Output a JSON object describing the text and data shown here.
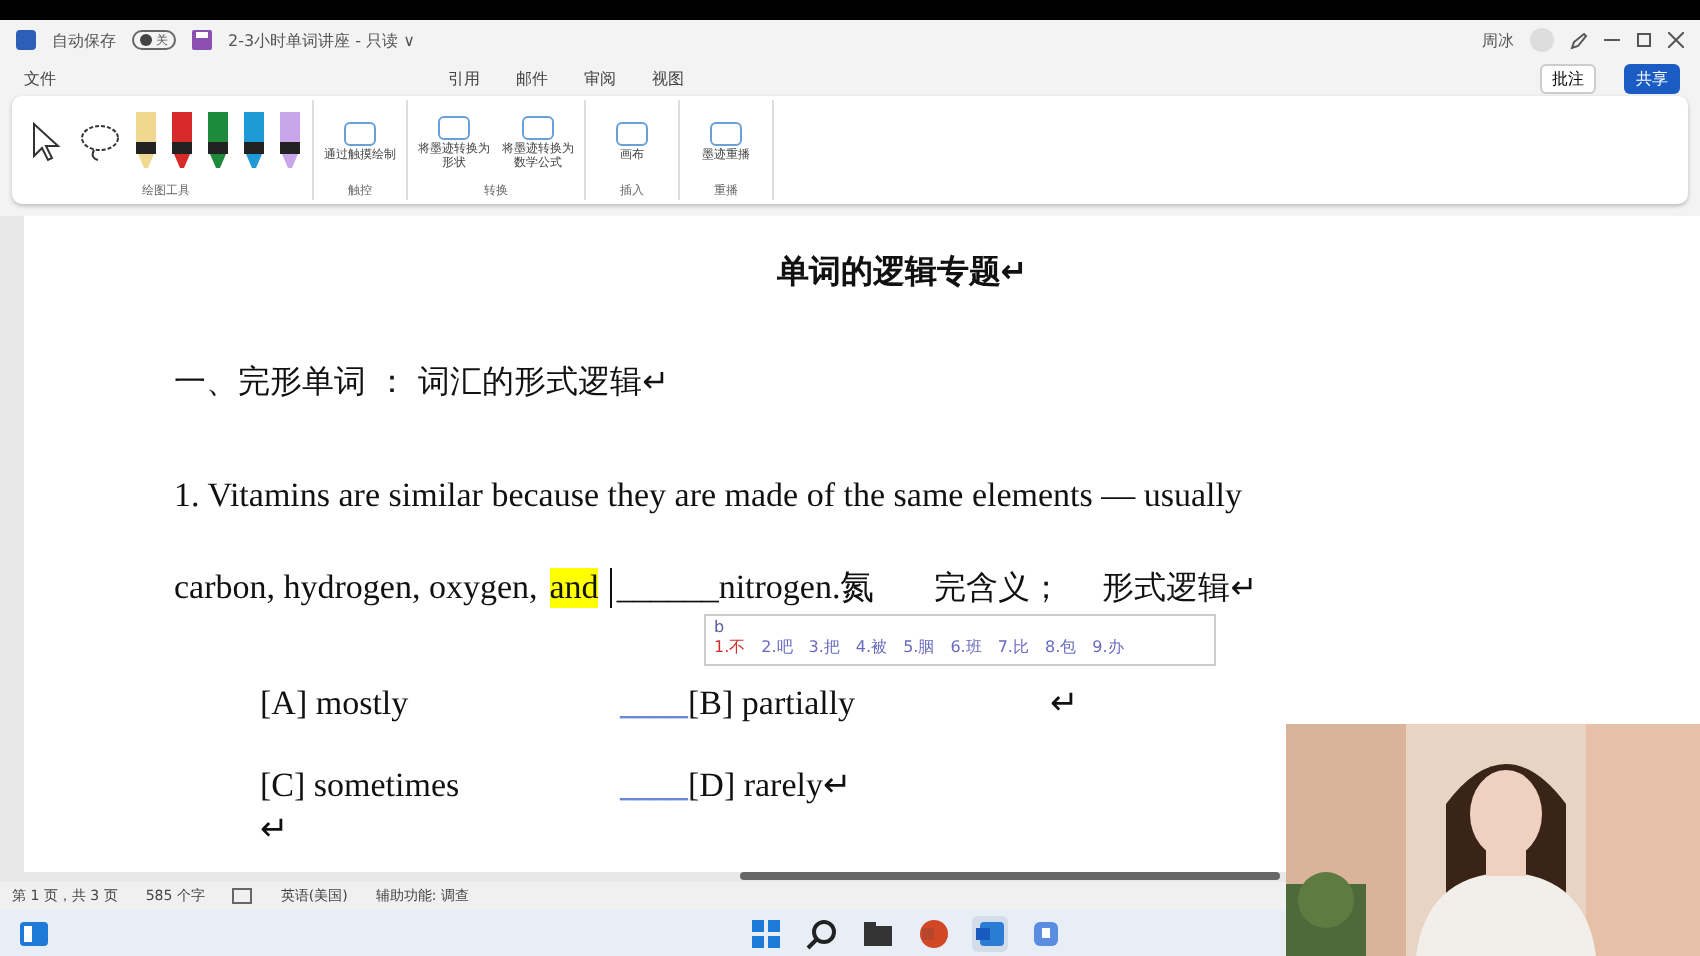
{
  "title_bar": {
    "autosave_label": "自动保存",
    "autosave_on": false,
    "toggle_text": "关",
    "document_title": "2-3小时单词讲座 - 只读 ∨",
    "user": "周冰"
  },
  "menu_tabs": [
    {
      "label": "文件",
      "selected": false
    },
    {
      "label": "引用",
      "selected": false
    },
    {
      "label": "邮件",
      "selected": false
    },
    {
      "label": "审阅",
      "selected": false
    },
    {
      "label": "视图",
      "selected": false
    }
  ],
  "ribbon": {
    "groups": [
      {
        "label": "绘图工具",
        "tools": [
          {
            "kind": "pointer"
          },
          {
            "kind": "lasso"
          },
          {
            "kind": "pen",
            "color": "#f0d890"
          },
          {
            "kind": "pen",
            "color": "#d92a2a"
          },
          {
            "kind": "pen",
            "color": "#1e8a3c"
          },
          {
            "kind": "pen",
            "color": "#1e9ad6"
          },
          {
            "kind": "pen",
            "color": "#c9a6ea"
          }
        ]
      },
      {
        "label": "触控",
        "buttons": [
          "通过触摸绘制"
        ]
      },
      {
        "label": "转换",
        "buttons": [
          "将墨迹转换为形状",
          "将墨迹转换为数学公式"
        ]
      },
      {
        "label": "插入",
        "buttons": [
          "画布"
        ]
      },
      {
        "label": "重播",
        "buttons": [
          "墨迹重播"
        ]
      }
    ]
  },
  "comment_button": "批注",
  "share_button": "共享",
  "document": {
    "title": "单词的逻辑专题↵",
    "heading": "一、完形单词 ： 词汇的形式逻辑↵",
    "question": {
      "line1": "1. Vitamins are similar because they are made of the same elements  —  usually",
      "line2_before": "carbon, hydrogen, oxygen,",
      "highlighted": "and",
      "blank": "______",
      "line2_after": "nitrogen.氮",
      "note1": "完含义；",
      "note2": "形式逻辑↵"
    },
    "ime": {
      "input": "b",
      "candidates": [
        {
          "text": "1.不",
          "selected": true
        },
        {
          "text": "2.吧",
          "selected": false
        },
        {
          "text": "3.把",
          "selected": false
        },
        {
          "text": "4.被",
          "selected": false
        },
        {
          "text": "5.胭",
          "selected": false
        },
        {
          "text": "6.班",
          "selected": false
        },
        {
          "text": "7.比",
          "selected": false
        },
        {
          "text": "8.包",
          "selected": false
        },
        {
          "text": "9.办",
          "selected": false
        }
      ]
    },
    "options": [
      [
        {
          "text": "[A] mostly"
        },
        {
          "blank": "____",
          "text": "[B] partially"
        },
        {
          "text": "↵"
        }
      ],
      [
        {
          "text": "[C] sometimes"
        },
        {
          "blank": "____",
          "text": "[D] rarely↵"
        }
      ]
    ],
    "end_mark": "↵"
  },
  "status_bar": [
    "第 1 页，共 3 页",
    "585 个字",
    "英语(美国)",
    "辅助功能: 调查"
  ],
  "taskbar": [
    {
      "kind": "start",
      "active": false
    },
    {
      "kind": "search",
      "active": false
    },
    {
      "kind": "files",
      "active": false
    },
    {
      "kind": "powerpoint",
      "active": false
    },
    {
      "kind": "word",
      "active": true
    },
    {
      "kind": "app",
      "active": false
    }
  ],
  "webcam": {
    "kind": "picture"
  }
}
